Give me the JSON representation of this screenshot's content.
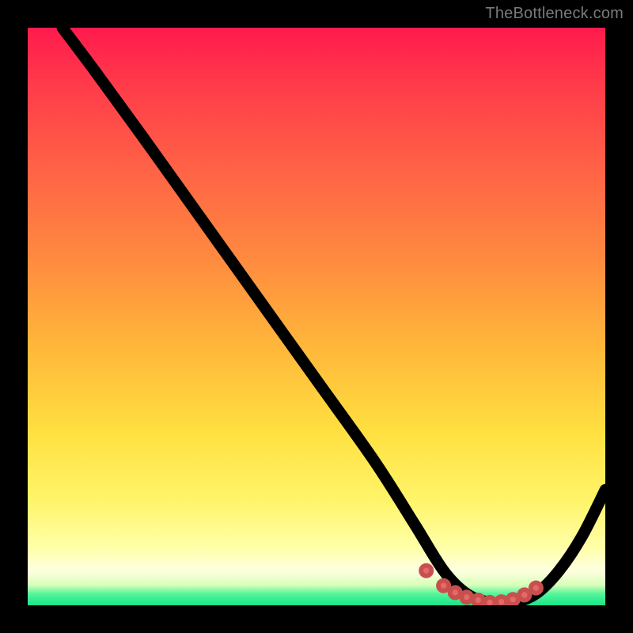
{
  "watermark": "TheBottleneck.com",
  "chart_data": {
    "type": "line",
    "title": "",
    "xlabel": "",
    "ylabel": "",
    "xlim": [
      0,
      100
    ],
    "ylim": [
      0,
      100
    ],
    "grid": false,
    "series": [
      {
        "name": "bottleneck-curve",
        "x": [
          6,
          12,
          20,
          30,
          40,
          50,
          60,
          67,
          72,
          76,
          80,
          84,
          88,
          92,
          96,
          100
        ],
        "y": [
          100,
          92,
          81,
          67,
          53,
          39,
          25,
          14,
          6,
          2,
          0.5,
          0.5,
          2,
          6,
          12,
          20
        ]
      }
    ],
    "markers": {
      "name": "sweet-spot-dots",
      "color": "#e46a6a",
      "x": [
        69,
        72,
        74,
        76,
        78,
        80,
        82,
        84,
        86,
        88
      ],
      "y": [
        6.0,
        3.4,
        2.2,
        1.4,
        0.9,
        0.5,
        0.6,
        1.0,
        1.8,
        3.0
      ]
    },
    "background": {
      "type": "vertical-gradient",
      "stops": [
        {
          "pos": 0.0,
          "color": "#ff1a4d"
        },
        {
          "pos": 0.5,
          "color": "#ffb63a"
        },
        {
          "pos": 0.85,
          "color": "#fff56a"
        },
        {
          "pos": 0.96,
          "color": "#d8ffb9"
        },
        {
          "pos": 1.0,
          "color": "#18e589"
        }
      ]
    }
  }
}
